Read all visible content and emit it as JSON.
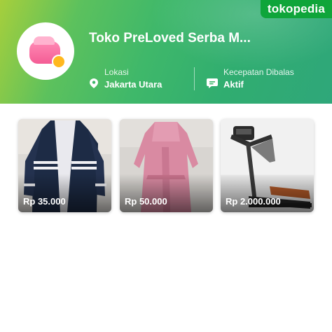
{
  "brand": {
    "label": "tokopedia",
    "color": "#0fa53a"
  },
  "store": {
    "name": "Toko PreLoved Serba M...",
    "location_label": "Lokasi",
    "location_value": "Jakarta Utara",
    "response_label": "Kecepatan Dibalas",
    "response_value": "Aktif",
    "avatar_icon": "wallet-icon"
  },
  "products": [
    {
      "price": "Rp 35.000",
      "image": "navy-cardigan-photo"
    },
    {
      "price": "Rp 50.000",
      "image": "pink-hijab-dress-photo"
    },
    {
      "price": "Rp 2.000.000",
      "image": "treadmill-photo"
    }
  ],
  "colors": {
    "banner_start": "#a6cf3c",
    "banner_end": "#2fa77a"
  }
}
